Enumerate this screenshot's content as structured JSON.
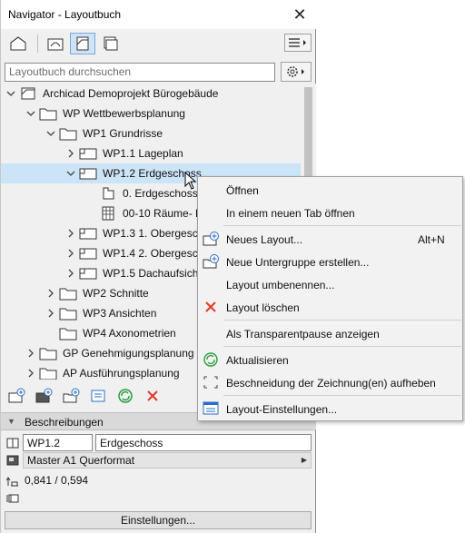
{
  "window": {
    "title": "Navigator - Layoutbuch",
    "close_glyph": "✕"
  },
  "toolbar": {
    "buttons": [
      {
        "icon": "project-map-icon",
        "active": false
      },
      {
        "icon": "view-map-icon",
        "active": false
      },
      {
        "icon": "layout-book-icon",
        "active": true
      },
      {
        "icon": "publisher-sets-icon",
        "active": false
      }
    ],
    "menu_icon": "hamburger-menu-icon"
  },
  "search": {
    "placeholder": "Layoutbuch durchsuchen",
    "value": ""
  },
  "tree": [
    {
      "label": "Archicad Demoprojekt Bürogebäude",
      "icon": "layout-book-icon",
      "expander": "expanded",
      "level": 0
    },
    {
      "label": "WP Wettbewerbsplanung",
      "icon": "folder-icon",
      "expander": "expanded",
      "level": 1
    },
    {
      "label": "WP1 Grundrisse",
      "icon": "folder-icon",
      "expander": "expanded",
      "level": 2
    },
    {
      "label": "WP1.1 Lageplan",
      "icon": "layout-sheet-icon",
      "expander": "collapsed",
      "level": 3
    },
    {
      "label": "WP1.2 Erdgeschoss",
      "icon": "layout-sheet-icon",
      "expander": "expanded",
      "level": 3,
      "selected": true
    },
    {
      "label": "0. Erdgeschoss",
      "icon": "drawing-icon",
      "expander": "none",
      "level": 4
    },
    {
      "label": "00-10 Räume- Räume",
      "icon": "table-icon",
      "expander": "none",
      "level": 4
    },
    {
      "label": "WP1.3 1. Obergeschoss",
      "icon": "layout-sheet-icon",
      "expander": "collapsed",
      "level": 3
    },
    {
      "label": "WP1.4 2. Obergeschoss",
      "icon": "layout-sheet-icon",
      "expander": "collapsed",
      "level": 3
    },
    {
      "label": "WP1.5 Dachaufsicht",
      "icon": "layout-sheet-icon",
      "expander": "collapsed",
      "level": 3
    },
    {
      "label": "WP2 Schnitte",
      "icon": "folder-icon",
      "expander": "collapsed",
      "level": 2
    },
    {
      "label": "WP3 Ansichten",
      "icon": "folder-icon",
      "expander": "collapsed",
      "level": 2
    },
    {
      "label": "WP4 Axonometrien",
      "icon": "folder-icon",
      "expander": "none",
      "level": 2
    },
    {
      "label": "GP Genehmigungsplanung",
      "icon": "folder-icon",
      "expander": "collapsed",
      "level": 1
    },
    {
      "label": "AP Ausführungsplanung",
      "icon": "folder-icon",
      "expander": "collapsed",
      "level": 1
    }
  ],
  "actions": [
    {
      "icon": "new-layout-icon"
    },
    {
      "icon": "new-master-icon"
    },
    {
      "icon": "new-subset-icon"
    },
    {
      "icon": "layout-settings-icon"
    },
    {
      "icon": "refresh-icon"
    },
    {
      "icon": "delete-icon"
    }
  ],
  "details": {
    "section_title": "Beschreibungen",
    "layout_id": "WP1.2",
    "layout_name": "Erdgeschoss",
    "master": "Master A1 Querformat",
    "size": "0,841 / 0,594",
    "settings_button": "Einstellungen..."
  },
  "context_menu": {
    "items": [
      {
        "label": "Öffnen",
        "icon": "",
        "shortcut": ""
      },
      {
        "label": "In einem neuen Tab öffnen",
        "icon": "",
        "shortcut": ""
      },
      {
        "label": "Neues Layout...",
        "icon": "new-layout-icon",
        "shortcut": "Alt+N"
      },
      {
        "label": "Neue Untergruppe erstellen...",
        "icon": "new-subset-icon",
        "shortcut": ""
      },
      {
        "label": "Layout umbenennen...",
        "icon": "",
        "shortcut": ""
      },
      {
        "label": "Layout löschen",
        "icon": "delete-icon",
        "shortcut": ""
      },
      {
        "label": "Als Transparentpause anzeigen",
        "icon": "",
        "shortcut": ""
      },
      {
        "label": "Aktualisieren",
        "icon": "refresh-icon",
        "shortcut": ""
      },
      {
        "label": "Beschneidung der Zeichnung(en) aufheben",
        "icon": "crop-icon",
        "shortcut": ""
      },
      {
        "label": "Layout-Einstellungen...",
        "icon": "layout-settings-icon",
        "shortcut": ""
      }
    ]
  },
  "colors": {
    "selection": "#cce4f7",
    "accent_blue": "#2b6cc4",
    "delete_red": "#e03b24",
    "refresh_green": "#2a9d3a"
  }
}
